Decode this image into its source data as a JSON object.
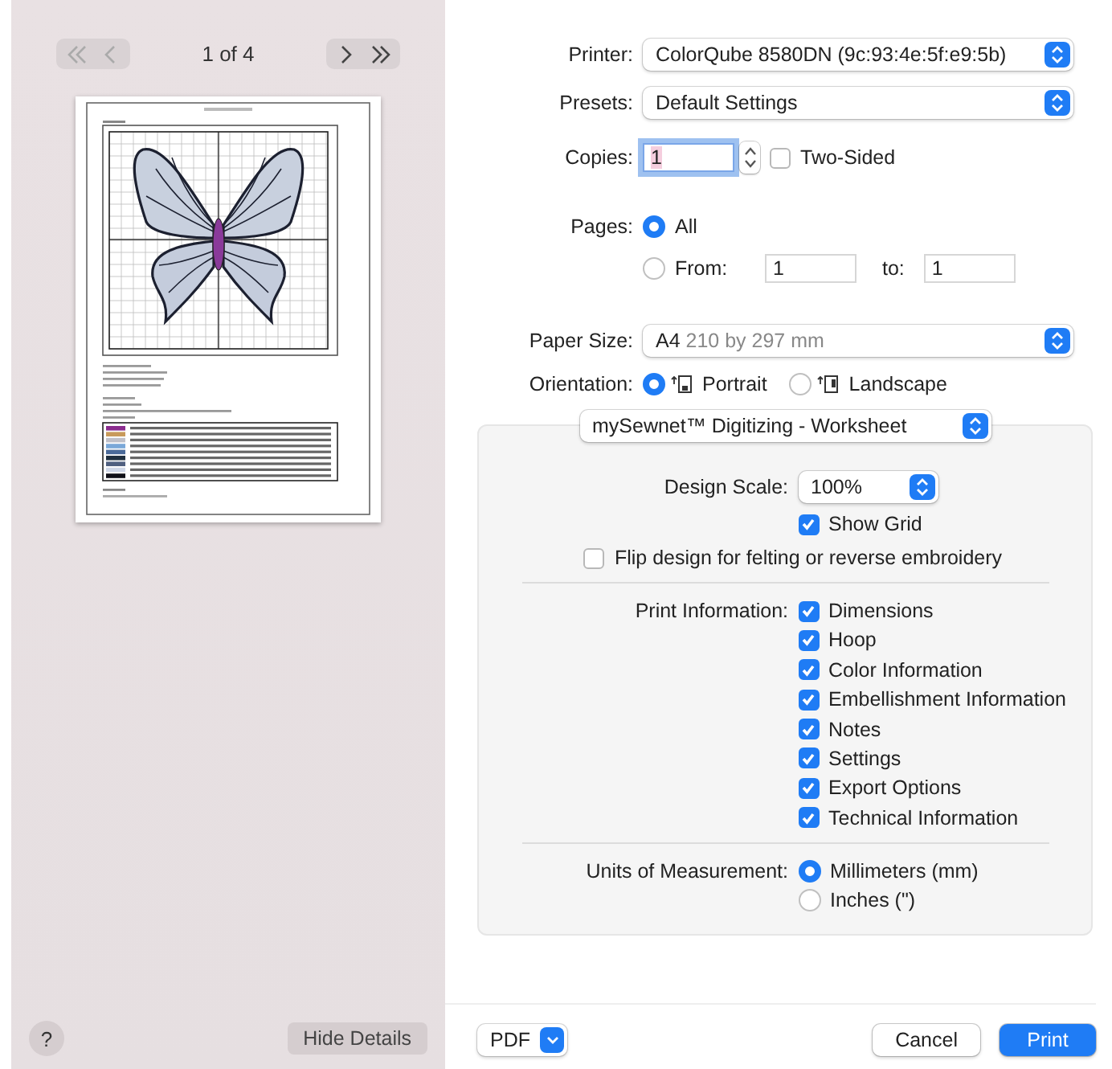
{
  "preview": {
    "nav": [
      {
        "kind": "first",
        "disabled": true
      },
      {
        "kind": "prev",
        "disabled": true
      },
      {
        "kind": "next",
        "disabled": false
      },
      {
        "kind": "last",
        "disabled": false
      }
    ],
    "page_counter": "1 of 4"
  },
  "printer": {
    "label": "Printer:",
    "value": "ColorQube 8580DN (9c:93:4e:5f:e9:5b)"
  },
  "presets": {
    "label": "Presets:",
    "value": "Default Settings"
  },
  "copies": {
    "label": "Copies:",
    "value": "1",
    "focused": true,
    "two_sided": {
      "label": "Two-Sided",
      "checked": false
    }
  },
  "pages": {
    "label": "Pages:",
    "all": {
      "label": "All",
      "selected": true
    },
    "range": {
      "label": "From:",
      "selected": false,
      "from": "1",
      "to_label": "to:",
      "to": "1"
    }
  },
  "paper_size": {
    "label": "Paper Size:",
    "value": "A4",
    "detail": "210 by 297 mm"
  },
  "orientation": {
    "label": "Orientation:",
    "options": [
      {
        "kind": "portrait",
        "label": "Portrait",
        "selected": true
      },
      {
        "kind": "landscape",
        "label": "Landscape",
        "selected": false
      }
    ]
  },
  "panel": {
    "menu": "mySewnet™ Digitizing - Worksheet",
    "design_scale": {
      "label": "Design Scale:",
      "value": "100%"
    },
    "show_grid": {
      "label": "Show Grid",
      "checked": true
    },
    "flip": {
      "label": "Flip design for felting or reverse embroidery",
      "checked": false
    },
    "print_information": {
      "label": "Print Information:",
      "items": [
        {
          "label": "Dimensions",
          "checked": true
        },
        {
          "label": "Hoop",
          "checked": true
        },
        {
          "label": "Color Information",
          "checked": true
        },
        {
          "label": "Embellishment Information",
          "checked": true
        },
        {
          "label": "Notes",
          "checked": true
        },
        {
          "label": "Settings",
          "checked": true
        },
        {
          "label": "Export Options",
          "checked": true
        },
        {
          "label": "Technical Information",
          "checked": true
        }
      ]
    },
    "units": {
      "label": "Units of Measurement:",
      "options": [
        {
          "label": "Millimeters (mm)",
          "selected": true
        },
        {
          "label": "Inches (\")",
          "selected": false
        }
      ]
    }
  },
  "footer": {
    "help": "?",
    "hide_details": "Hide Details",
    "pdf": "PDF",
    "cancel": "Cancel",
    "print": "Print"
  }
}
